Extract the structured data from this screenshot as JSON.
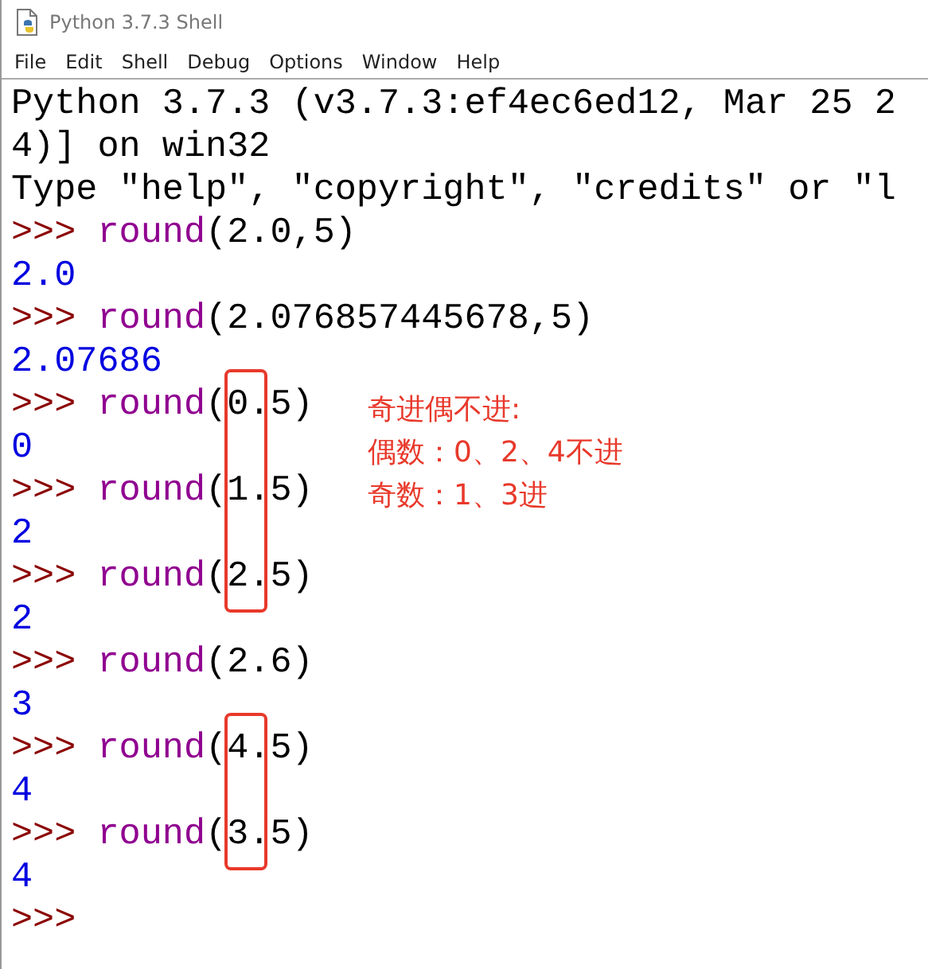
{
  "window": {
    "title": "Python 3.7.3 Shell"
  },
  "menu": [
    "File",
    "Edit",
    "Shell",
    "Debug",
    "Options",
    "Window",
    "Help"
  ],
  "lines": [
    {
      "kind": "output",
      "text": "Python 3.7.3 (v3.7.3:ef4ec6ed12, Mar 25 2"
    },
    {
      "kind": "output",
      "text": "4)] on win32"
    },
    {
      "kind": "output",
      "text": "Type \"help\", \"copyright\", \"credits\" or \"l"
    },
    {
      "kind": "input",
      "prompt": ">>>",
      "call": "round",
      "args": "(2.0,5)",
      "boxed": false
    },
    {
      "kind": "result",
      "text": "2.0"
    },
    {
      "kind": "input",
      "prompt": ">>>",
      "call": "round",
      "args": "(2.076857445678,5)",
      "boxed": false
    },
    {
      "kind": "result",
      "text": "2.07686"
    },
    {
      "kind": "input",
      "prompt": ">>>",
      "call": "round",
      "args": "(0.5)",
      "boxed": true
    },
    {
      "kind": "result",
      "text": "0"
    },
    {
      "kind": "input",
      "prompt": ">>>",
      "call": "round",
      "args": "(1.5)",
      "boxed": true
    },
    {
      "kind": "result",
      "text": "2"
    },
    {
      "kind": "input",
      "prompt": ">>>",
      "call": "round",
      "args": "(2.5)",
      "boxed": true
    },
    {
      "kind": "result",
      "text": "2"
    },
    {
      "kind": "input",
      "prompt": ">>>",
      "call": "round",
      "args": "(2.6)",
      "boxed": false
    },
    {
      "kind": "result",
      "text": "3"
    },
    {
      "kind": "input",
      "prompt": ">>>",
      "call": "round",
      "args": "(4.5)",
      "boxed": true
    },
    {
      "kind": "result",
      "text": "4"
    },
    {
      "kind": "input",
      "prompt": ">>>",
      "call": "round",
      "args": "(3.5)",
      "boxed": true
    },
    {
      "kind": "result",
      "text": "4"
    },
    {
      "kind": "input",
      "prompt": ">>>"
    }
  ],
  "note": {
    "lines": [
      "奇进偶不进:",
      "偶数：0、2、4不进",
      "奇数：1、3进"
    ]
  }
}
